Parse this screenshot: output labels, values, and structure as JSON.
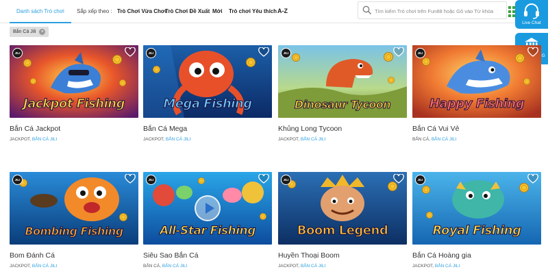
{
  "header": {
    "active_tab": "Danh sách Trò chơi",
    "sort_label": "Sắp xếp theo :",
    "sort_options": [
      "Trò Chơi Vừa Chơi",
      "Trò Chơi Đề Xuất",
      "Mới",
      "Trò chơi Yêu thích",
      "A-Z"
    ],
    "search_placeholder": "Tìm kiếm Trò chơi trên Fun88 hoặc Gõ vào Từ khóa"
  },
  "side_widgets": {
    "live_chat": "Live Chat",
    "bank": "NGÂN HÀNG"
  },
  "filter_chip": {
    "label": "Bắn Cá Jili",
    "close": "×"
  },
  "colors": {
    "accent": "#2a9fe0",
    "widget": "#1a9be0"
  },
  "games": [
    {
      "title": "Bắn Cá Jackpot",
      "tag1": "JACKPOT,",
      "tag2": "BẮN CÁ JILI",
      "badge": "JILI",
      "logo": "Jackpot Fishing",
      "icon": "heart-icon"
    },
    {
      "title": "Bắn Cá Mega",
      "tag1": "JACKPOT,",
      "tag2": "BẮN CÁ JILI",
      "badge": "JILI",
      "logo": "Mega Fishing",
      "icon": "heart-icon"
    },
    {
      "title": "Khủng Long Tycoon",
      "tag1": "JACKPOT,",
      "tag2": "BẮN CÁ JILI",
      "badge": "JILI",
      "logo": "Dinosaur Tycoon",
      "icon": "heart-icon"
    },
    {
      "title": "Bắn Cá Vui Vẻ",
      "tag1": "BẮN CÁ,",
      "tag2": "BẮN CÁ JILI",
      "badge": "JILI",
      "logo": "Happy Fishing",
      "icon": "heart-icon"
    },
    {
      "title": "Bom Đánh Cá",
      "tag1": "JACKPOT,",
      "tag2": "BẮN CÁ JILI",
      "badge": "JILI",
      "logo": "Bombing Fishing",
      "icon": "heart-icon"
    },
    {
      "title": "Siêu Sao Bắn Cá",
      "tag1": "BẮN CÁ,",
      "tag2": "BẮN CÁ JILI",
      "badge": "JILI",
      "logo": "All-Star Fishing",
      "icon": "heart-icon"
    },
    {
      "title": "Huyền Thoại Boom",
      "tag1": "JACKPOT,",
      "tag2": "BẮN CÁ JILI",
      "badge": "JILI",
      "logo": "Boom Legend",
      "icon": "heart-icon"
    },
    {
      "title": "Bắn Cá Hoàng gia",
      "tag1": "JACKPOT,",
      "tag2": "BẮN CÁ JILI",
      "badge": "JILI",
      "logo": "Royal Fishing",
      "icon": "heart-icon"
    }
  ]
}
